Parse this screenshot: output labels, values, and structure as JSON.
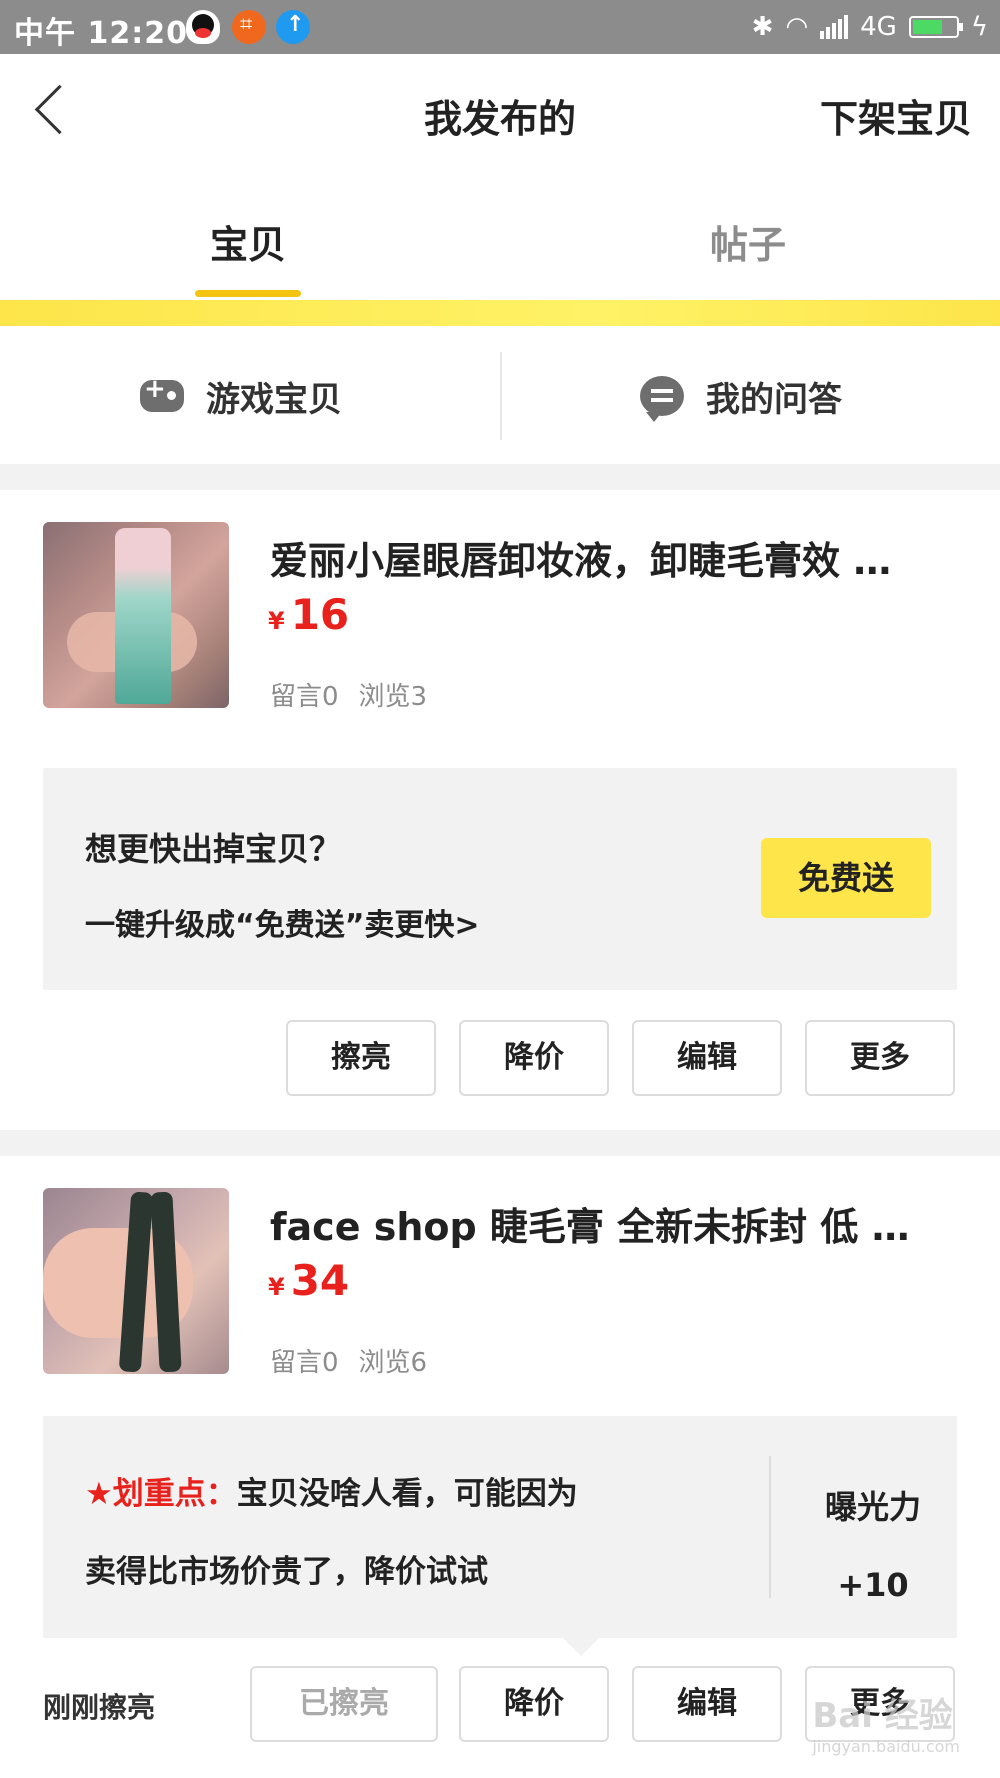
{
  "status_bar": {
    "time": "中午 12:20",
    "network": "4G",
    "battery_level": 0.7
  },
  "header": {
    "title": "我发布的",
    "action": "下架宝贝"
  },
  "tabs": [
    {
      "label": "宝贝",
      "active": true
    },
    {
      "label": "帖子",
      "active": false
    }
  ],
  "subnav": {
    "games_label": "游戏宝贝",
    "qa_label": "我的问答"
  },
  "items": [
    {
      "title": "爱丽小屋眼唇卸妆液，卸睫毛膏效 …",
      "price_symbol": "¥",
      "price": "16",
      "comments": "留言0",
      "views": "浏览3",
      "promo": {
        "line1": "想更快出掉宝贝？",
        "line2": "一键升级成“免费送”卖更快>",
        "button": "免费送"
      },
      "actions": [
        "擦亮",
        "降价",
        "编辑",
        "更多"
      ]
    },
    {
      "title": "face shop 睫毛膏  全新未拆封 低 …",
      "price_symbol": "¥",
      "price": "34",
      "comments": "留言0",
      "views": "浏览6",
      "tip": {
        "highlight": "★划重点：",
        "line1": "宝贝没啥人看，可能因为",
        "line2": "卖得比市场价贵了，降价试试",
        "exposure_label": "曝光力",
        "exposure_value": "+10"
      },
      "status_label": "刚刚擦亮",
      "actions": [
        "已擦亮",
        "降价",
        "编辑",
        "更多"
      ]
    }
  ],
  "watermark": {
    "text": "Bai 经验",
    "url": "jingyan.baidu.com"
  },
  "colors": {
    "accent_yellow": "#fde54a",
    "price_red": "#e8211d",
    "status_bar": "#8c8c8c"
  }
}
